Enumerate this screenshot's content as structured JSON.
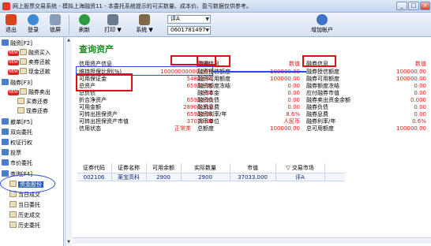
{
  "window": {
    "title": "网上股票交易系统 - 模拟上海融资11 - 本委托系统提示的可买数量、成本价、盈亏数据仅供参考。",
    "min": "_",
    "max": "□",
    "close": "×"
  },
  "toolbar": {
    "exit": "退出",
    "login": "登录",
    "lock": "锁屏",
    "refresh": "刷新",
    "print": "打印",
    "print_arrow": "▼",
    "system": "系统",
    "system_arrow": "▼",
    "market_select": "评A",
    "account_select": "0601781497",
    "add_account": "增加帐户"
  },
  "sidebar": {
    "items": [
      {
        "label": "融资[F2]",
        "kind": "group"
      },
      {
        "label": "融资买入",
        "kind": "leaf",
        "badge": "NEW"
      },
      {
        "label": "卖券还款",
        "kind": "leaf",
        "badge": "NEW"
      },
      {
        "label": "现金还款",
        "kind": "leaf",
        "badge": "NEW"
      },
      {
        "label": "融券[F3]",
        "kind": "group"
      },
      {
        "label": "融券卖出",
        "kind": "leaf",
        "badge": "NEW"
      },
      {
        "label": "买券还券",
        "kind": "leaf"
      },
      {
        "label": "现券还券",
        "kind": "leaf"
      },
      {
        "label": "撤单[F5]",
        "kind": "group"
      },
      {
        "label": "双向委托",
        "kind": "group"
      },
      {
        "label": "权证行权",
        "kind": "group"
      },
      {
        "label": "投票",
        "kind": "group"
      },
      {
        "label": "市价委托",
        "kind": "group"
      },
      {
        "label": "查询[F4]",
        "kind": "group"
      },
      {
        "label": "资金股份",
        "kind": "leaf",
        "selected": true
      },
      {
        "label": "当日成交",
        "kind": "leaf"
      },
      {
        "label": "当日委托",
        "kind": "leaf"
      },
      {
        "label": "历史成交",
        "kind": "leaf"
      },
      {
        "label": "历史委托",
        "kind": "leaf"
      }
    ]
  },
  "main": {
    "title": "查询资产",
    "col1": {
      "header": "信用资产信息",
      "header_value": "数值",
      "rows": [
        {
          "label": "维持担保比例(%)",
          "value": "10000000000.00%"
        },
        {
          "label": "可用保证金",
          "value": "54823.41"
        },
        {
          "label": "总资产",
          "value": "65933.31"
        },
        {
          "label": "总负债",
          "value": "0.00"
        },
        {
          "label": "折合净资产",
          "value": "65933.31"
        },
        {
          "label": "可用金额",
          "value": "28900.310"
        },
        {
          "label": "可转出担保资产",
          "value": "65933.31"
        },
        {
          "label": "可转出担保资产市值",
          "value": "37033.00"
        },
        {
          "label": "信用状态",
          "value": "正常类"
        }
      ]
    },
    "col2": {
      "header": "融资信息",
      "header_value": "数值",
      "rows": [
        {
          "label": "融资授信额度",
          "value": "100000.00"
        },
        {
          "label": "融资可用额度",
          "value": "100000.00"
        },
        {
          "label": "融资额度冻结",
          "value": "0.00"
        },
        {
          "label": "融资本金",
          "value": "0.00"
        },
        {
          "label": "融资负债",
          "value": "0.00"
        },
        {
          "label": "融资息费",
          "value": "0.00"
        },
        {
          "label": "融资利率/年",
          "value": "8.6%"
        },
        {
          "label": "货币单位",
          "value": "人民币"
        },
        {
          "label": "总额度",
          "value": "100000.00"
        }
      ]
    },
    "col3": {
      "header": "融券信息",
      "header_value": "数值",
      "rows": [
        {
          "label": "融券授信额度",
          "value": "100000.00"
        },
        {
          "label": "融券可用额度",
          "value": "100000.00"
        },
        {
          "label": "融券额度冻结",
          "value": "0.00"
        },
        {
          "label": "应付融券市值",
          "value": "0.00"
        },
        {
          "label": "融券卖出资金余额",
          "value": "0.000"
        },
        {
          "label": "融券负债",
          "value": "0.00"
        },
        {
          "label": "融券息费",
          "value": "0.00"
        },
        {
          "label": "融券利率/年",
          "value": "0.6%"
        },
        {
          "label": "总可用额度",
          "value": "100000.00"
        }
      ]
    },
    "grid": {
      "headers": [
        "证券代码",
        "证券名称",
        "可用余额",
        "实际数量",
        "市值",
        "交易市场"
      ],
      "sort_indicator": "▽",
      "rows": [
        [
          "002106",
          "莱宝高科",
          "2900",
          "2900",
          "37033.000",
          "评A"
        ]
      ]
    }
  }
}
